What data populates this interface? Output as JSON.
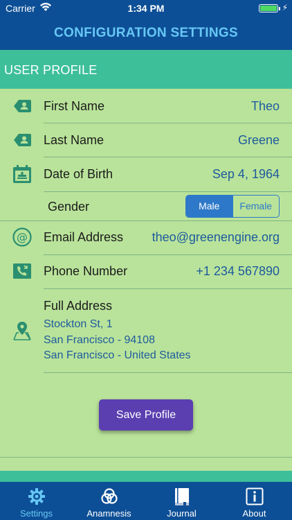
{
  "status": {
    "carrier": "Carrier",
    "time": "1:34 PM"
  },
  "nav": {
    "title": "CONFIGURATION SETTINGS"
  },
  "section": {
    "title": "USER PROFILE"
  },
  "profile": {
    "first_name_label": "First Name",
    "first_name_value": "Theo",
    "last_name_label": "Last Name",
    "last_name_value": "Greene",
    "dob_label": "Date of Birth",
    "dob_value": "Sep 4, 1964",
    "gender_label": "Gender",
    "gender_options": [
      "Male",
      "Female"
    ],
    "gender_selected": "Male",
    "email_label": "Email Address",
    "email_value": "theo@greenengine.org",
    "phone_label": "Phone Number",
    "phone_value": "+1 234 567890",
    "address_label": "Full Address",
    "address_lines": [
      "Stockton St, 1",
      "San Francisco - 94108",
      "San Francisco - United States"
    ]
  },
  "save_button": "Save Profile",
  "tabs": [
    {
      "label": "Settings",
      "icon": "gear-icon",
      "active": true
    },
    {
      "label": "Anamnesis",
      "icon": "rings-icon",
      "active": false
    },
    {
      "label": "Journal",
      "icon": "book-icon",
      "active": false
    },
    {
      "label": "About",
      "icon": "info-icon",
      "active": false
    }
  ],
  "colors": {
    "nav_bg": "#0d4f96",
    "nav_title": "#67c7f5",
    "section_bg": "#3dbf9a",
    "content_bg": "#b9e39a",
    "value_text": "#1e5a9e",
    "icon_green": "#2a8f70",
    "button_bg": "#5b3fb0",
    "segment_blue": "#2d78c8"
  }
}
